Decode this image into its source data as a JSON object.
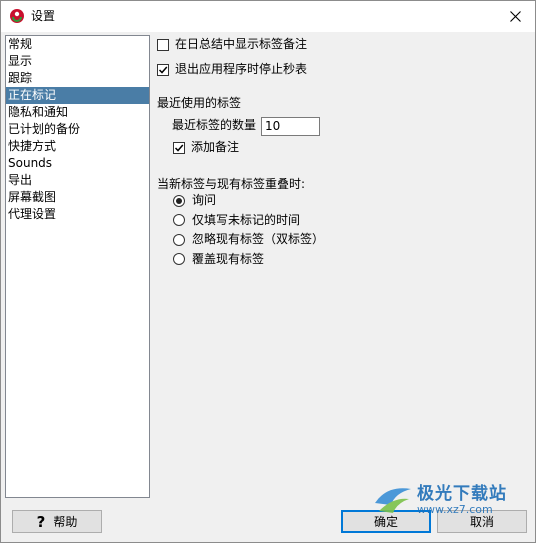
{
  "window": {
    "title": "设置"
  },
  "sidebar": {
    "items": [
      {
        "label": "常规",
        "selected": false
      },
      {
        "label": "显示",
        "selected": false
      },
      {
        "label": "跟踪",
        "selected": false
      },
      {
        "label": "正在标记",
        "selected": true
      },
      {
        "label": "隐私和通知",
        "selected": false
      },
      {
        "label": "已计划的备份",
        "selected": false
      },
      {
        "label": "快捷方式",
        "selected": false
      },
      {
        "label": "Sounds",
        "selected": false
      },
      {
        "label": "导出",
        "selected": false
      },
      {
        "label": "屏幕截图",
        "selected": false
      },
      {
        "label": "代理设置",
        "selected": false
      }
    ],
    "selected_color": "#4a7da6"
  },
  "options": {
    "show_tag_notes": {
      "label": "在日总结中显示标签备注",
      "checked": false
    },
    "stop_stopwatch_on_exit": {
      "label": "退出应用程序时停止秒表",
      "checked": true
    }
  },
  "recent_tags": {
    "heading": "最近使用的标签",
    "count_label": "最近标签的数量",
    "count_value": "10",
    "add_notes": {
      "label": "添加备注",
      "checked": true
    }
  },
  "overlap": {
    "heading": "当新标签与现有标签重叠时:",
    "choices": [
      {
        "label": "询问",
        "selected": true
      },
      {
        "label": "仅填写未标记的时间",
        "selected": false
      },
      {
        "label": "忽略现有标签（双标签）",
        "selected": false
      },
      {
        "label": "覆盖现有标签",
        "selected": false
      }
    ]
  },
  "buttons": {
    "help": "帮助",
    "ok": "确定",
    "cancel": "取消"
  },
  "watermark": {
    "title": "极光下载站",
    "url": "www.xz7.com"
  }
}
